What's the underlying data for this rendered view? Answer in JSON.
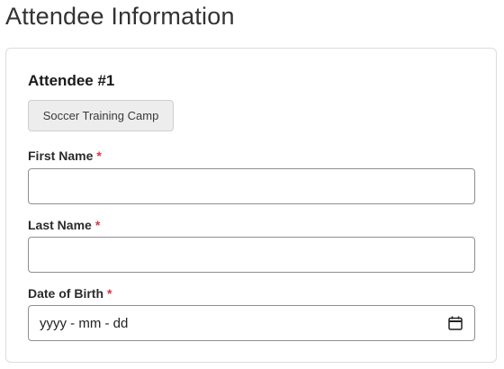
{
  "page": {
    "title": "Attendee Information"
  },
  "attendee": {
    "heading": "Attendee #1",
    "event_badge": "Soccer Training Camp"
  },
  "fields": {
    "first_name": {
      "label": "First Name",
      "required_mark": "*",
      "value": "",
      "placeholder": ""
    },
    "last_name": {
      "label": "Last Name",
      "required_mark": "*",
      "value": "",
      "placeholder": ""
    },
    "date_of_birth": {
      "label": "Date of Birth",
      "required_mark": "*",
      "placeholder_display": "yyyy - mm - dd",
      "icon": "calendar-icon"
    }
  },
  "colors": {
    "required": "#dc3545",
    "border": "#8f8f8f",
    "badge_bg": "#ededed"
  }
}
